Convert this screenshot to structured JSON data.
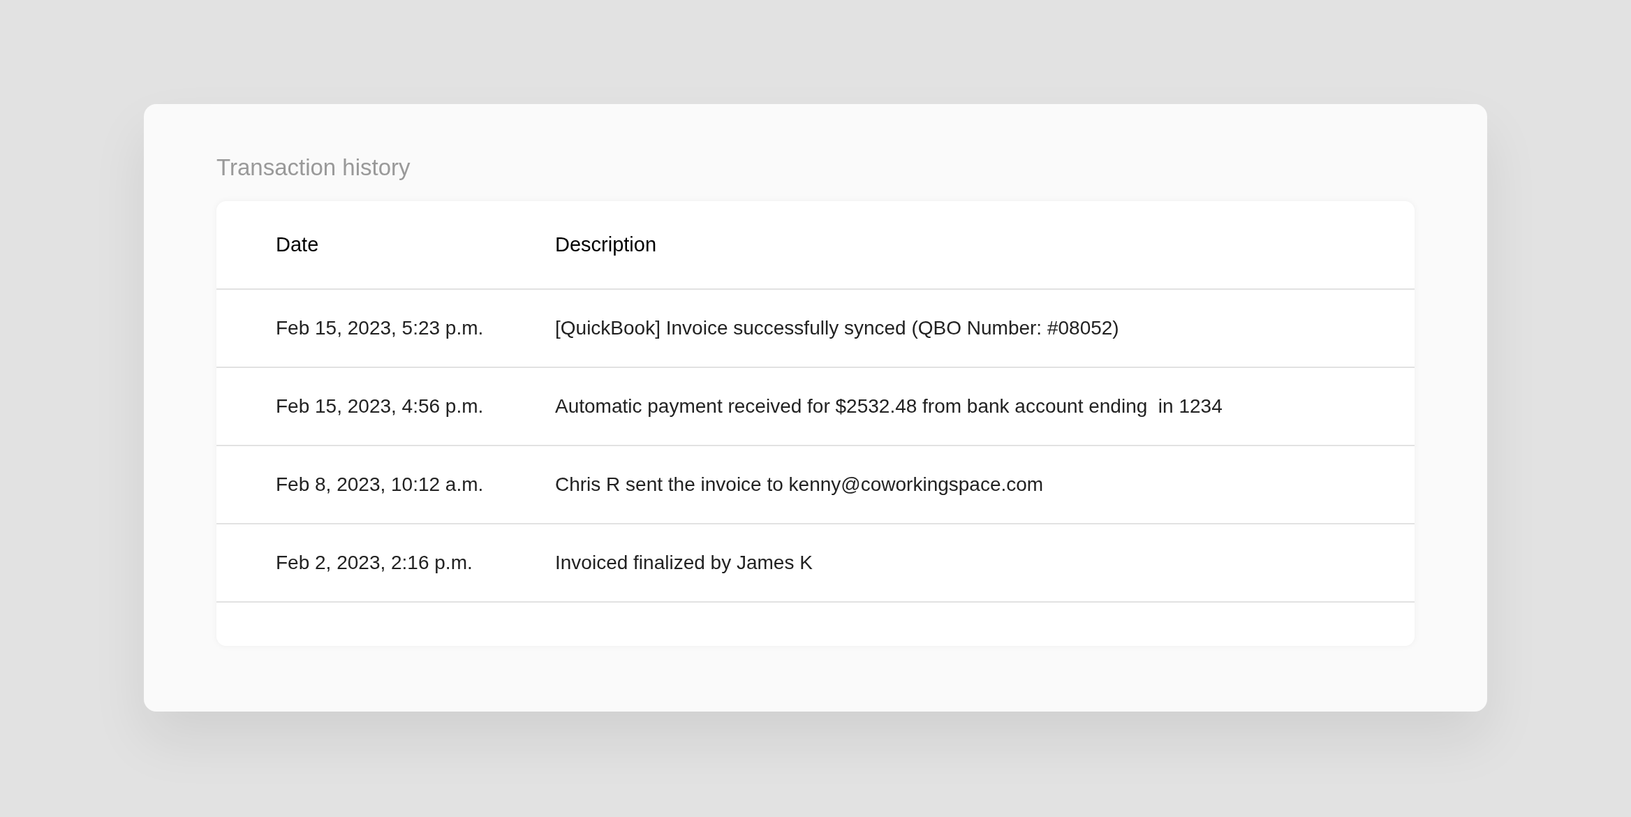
{
  "title": "Transaction history",
  "table": {
    "columns": [
      "Date",
      "Description"
    ],
    "rows": [
      {
        "date": "Feb 15, 2023, 5:23 p.m.",
        "description": "[QuickBook] Invoice successfully synced (QBO Number: #08052)"
      },
      {
        "date": "Feb 15, 2023, 4:56 p.m.",
        "description": "Automatic payment received for $2532.48 from bank account ending  in 1234"
      },
      {
        "date": "Feb 8, 2023, 10:12 a.m.",
        "description": "Chris R sent the invoice to kenny@coworkingspace.com"
      },
      {
        "date": "Feb 2, 2023, 2:16 p.m.",
        "description": "Invoiced finalized by James K"
      }
    ]
  }
}
